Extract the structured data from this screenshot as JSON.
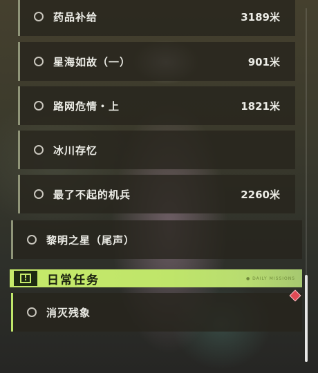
{
  "quests": [
    {
      "label": "药品补给",
      "distance": "3189米"
    },
    {
      "label": "星海如故（一）",
      "distance": "901米"
    },
    {
      "label": "路网危情・上",
      "distance": "1821米"
    },
    {
      "label": "冰川存忆",
      "distance": ""
    },
    {
      "label": "最了不起的机兵",
      "distance": "2260米"
    },
    {
      "label": "黎明之星（尾声）",
      "distance": ""
    }
  ],
  "daily_section": {
    "title": "日常任务",
    "icon": "exclamation-icon",
    "tag": "● DAILY MISSIONS"
  },
  "daily_quests": [
    {
      "label": "消灭残象",
      "distance": ""
    }
  ],
  "colors": {
    "accent": "#c6ea6a",
    "marker": "#e04a55"
  }
}
